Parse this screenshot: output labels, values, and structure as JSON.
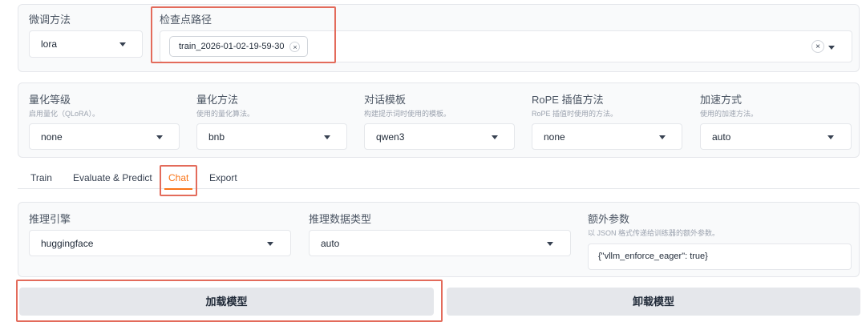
{
  "row1": {
    "finetune": {
      "label": "微调方法",
      "value": "lora"
    },
    "checkpoint": {
      "label": "检查点路径",
      "chip": "train_2026-01-02-19-59-30",
      "chip_remove": "×",
      "clear": "×"
    }
  },
  "row2": [
    {
      "label": "量化等级",
      "sub": "启用量化（QLoRA）。",
      "value": "none"
    },
    {
      "label": "量化方法",
      "sub": "使用的量化算法。",
      "value": "bnb"
    },
    {
      "label": "对话模板",
      "sub": "构建提示词时使用的模板。",
      "value": "qwen3"
    },
    {
      "label": "RoPE 插值方法",
      "sub": "RoPE 插值时使用的方法。",
      "value": "none"
    },
    {
      "label": "加速方式",
      "sub": "使用的加速方法。",
      "value": "auto"
    }
  ],
  "tabs": [
    "Train",
    "Evaluate & Predict",
    "Chat",
    "Export"
  ],
  "active_tab": "Chat",
  "chat": {
    "engine": {
      "label": "推理引擎",
      "value": "huggingface"
    },
    "dtype": {
      "label": "推理数据类型",
      "value": "auto"
    },
    "extra": {
      "label": "额外参数",
      "sub": "以 JSON 格式传递给训练器的额外参数。",
      "value": "{\"vllm_enforce_eager\": true}"
    }
  },
  "buttons": {
    "load": "加载模型",
    "unload": "卸载模型"
  },
  "colors": {
    "accent": "#f97316",
    "highlight_box": "#e36b5b",
    "panel_bg": "#f9fafb"
  },
  "icons": {
    "dropdown": "chevron-down-icon",
    "clear": "close-icon"
  }
}
